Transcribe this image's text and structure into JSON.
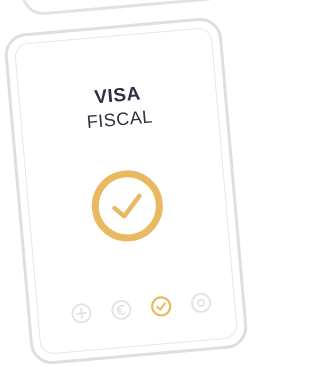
{
  "screen": {
    "title_line1": "VISA",
    "title_line2": "FISCAL"
  },
  "status": {
    "icon": "check-circle-icon",
    "color": "#E8B960"
  },
  "pagination": {
    "steps": [
      {
        "icon": "plus-circle-icon",
        "state": "inactive"
      },
      {
        "icon": "euro-circle-icon",
        "state": "inactive"
      },
      {
        "icon": "check-circle-icon",
        "state": "active"
      },
      {
        "icon": "target-circle-icon",
        "state": "inactive"
      }
    ],
    "active_color": "#E8B960",
    "inactive_color": "#E4E4E4"
  }
}
